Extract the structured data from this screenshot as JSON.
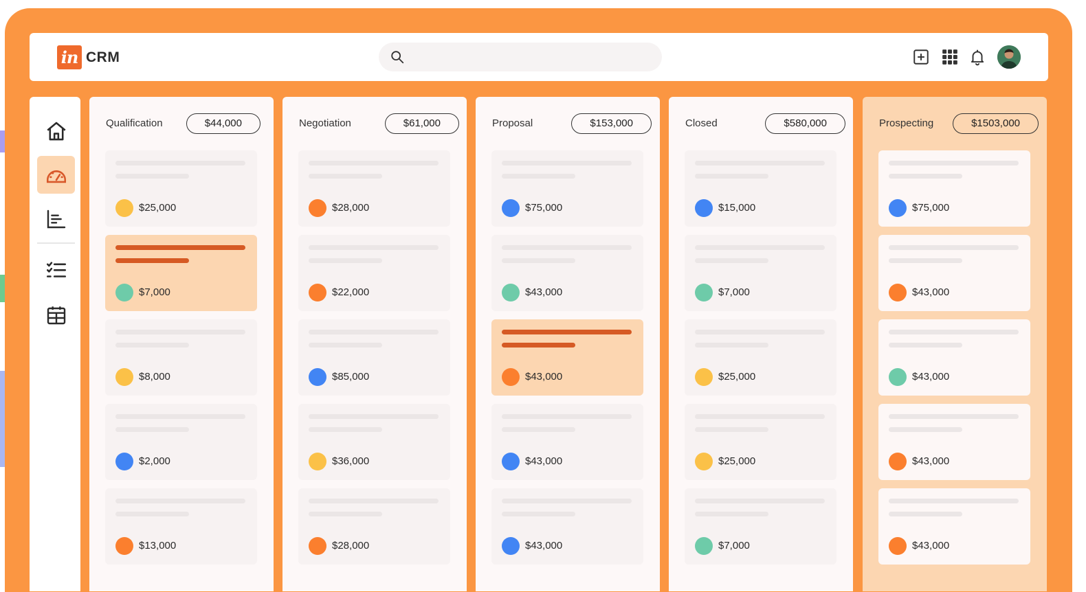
{
  "app": {
    "logo_mark": "in",
    "name": "CRM"
  },
  "search": {
    "placeholder": ""
  },
  "toolbar": {
    "icons": [
      "add-icon",
      "apps-grid-icon",
      "bell-icon",
      "avatar"
    ]
  },
  "sidebar": {
    "items": [
      "home-icon",
      "dashboard-icon",
      "reports-icon",
      "tasks-icon",
      "calendar-icon"
    ],
    "active": "dashboard-icon"
  },
  "colors": {
    "accent": "#fb9642",
    "highlight": "#fcd6b1",
    "yellow": "#fbc148",
    "orange": "#fb7f2e",
    "blue": "#4285f4",
    "green": "#6ecba9"
  },
  "columns": [
    {
      "title": "Qualification",
      "total": "$44,000",
      "cards": [
        {
          "amount": "$25,000",
          "dot": "yellow"
        },
        {
          "amount": "$7,000",
          "dot": "green",
          "selected": true
        },
        {
          "amount": "$8,000",
          "dot": "yellow"
        },
        {
          "amount": "$2,000",
          "dot": "blue"
        },
        {
          "amount": "$13,000",
          "dot": "orange"
        }
      ]
    },
    {
      "title": "Negotiation",
      "total": "$61,000",
      "cards": [
        {
          "amount": "$28,000",
          "dot": "orange"
        },
        {
          "amount": "$22,000",
          "dot": "orange"
        },
        {
          "amount": "$85,000",
          "dot": "blue"
        },
        {
          "amount": "$36,000",
          "dot": "yellow"
        },
        {
          "amount": "$28,000",
          "dot": "orange"
        }
      ]
    },
    {
      "title": "Proposal",
      "total": "$153,000",
      "cards": [
        {
          "amount": "$75,000",
          "dot": "blue"
        },
        {
          "amount": "$43,000",
          "dot": "green"
        },
        {
          "amount": "$43,000",
          "dot": "orange",
          "selected": true
        },
        {
          "amount": "$43,000",
          "dot": "blue"
        },
        {
          "amount": "$43,000",
          "dot": "blue"
        }
      ]
    },
    {
      "title": "Closed",
      "total": "$580,000",
      "cards": [
        {
          "amount": "$15,000",
          "dot": "blue"
        },
        {
          "amount": "$7,000",
          "dot": "green"
        },
        {
          "amount": "$25,000",
          "dot": "yellow"
        },
        {
          "amount": "$25,000",
          "dot": "yellow"
        },
        {
          "amount": "$7,000",
          "dot": "green"
        }
      ]
    },
    {
      "title": "Prospecting",
      "total": "$1503,000",
      "highlight": true,
      "cards": [
        {
          "amount": "$75,000",
          "dot": "blue"
        },
        {
          "amount": "$43,000",
          "dot": "orange"
        },
        {
          "amount": "$43,000",
          "dot": "green"
        },
        {
          "amount": "$43,000",
          "dot": "orange"
        },
        {
          "amount": "$43,000",
          "dot": "orange"
        }
      ]
    }
  ]
}
